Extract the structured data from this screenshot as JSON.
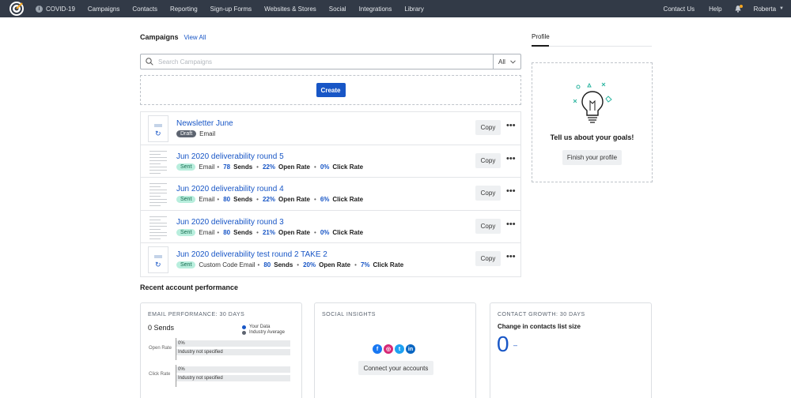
{
  "nav": {
    "items": [
      "COVID-19",
      "Campaigns",
      "Contacts",
      "Reporting",
      "Sign-up Forms",
      "Websites & Stores",
      "Social",
      "Integrations",
      "Library"
    ],
    "right": {
      "contact": "Contact Us",
      "help": "Help",
      "user": "Roberta"
    }
  },
  "campaigns": {
    "title": "Campaigns",
    "view_all": "View All",
    "search_placeholder": "Search Campaigns",
    "filter": "All",
    "create_label": "Create",
    "copy_label": "Copy",
    "rows": [
      {
        "name": "Newsletter June",
        "status": "Draft",
        "type": "Email",
        "sends": "",
        "open": "",
        "click": ""
      },
      {
        "name": "Jun 2020 deliverability round 5",
        "status": "Sent",
        "type": "Email",
        "sends": "78",
        "open": "22%",
        "click": "0%"
      },
      {
        "name": "Jun 2020 deliverability round 4",
        "status": "Sent",
        "type": "Email",
        "sends": "80",
        "open": "22%",
        "click": "6%"
      },
      {
        "name": "Jun 2020 deliverability round 3",
        "status": "Sent",
        "type": "Email",
        "sends": "80",
        "open": "21%",
        "click": "0%"
      },
      {
        "name": "Jun 2020 deliverability test round 2 TAKE 2",
        "status": "Sent",
        "type": "Custom Code Email",
        "sends": "80",
        "open": "20%",
        "click": "7%"
      }
    ],
    "labels": {
      "sends": "Sends",
      "open": "Open Rate",
      "click": "Click Rate"
    }
  },
  "recent": {
    "title": "Recent account performance",
    "email": {
      "label": "EMAIL PERFORMANCE: 30 DAYS",
      "sends": "0 Sends",
      "legend_your": "Your Data",
      "legend_industry": "Industry Average",
      "open_label": "Open Rate",
      "click_label": "Click Rate",
      "open_value": "0%",
      "click_value": "0%",
      "industry_text": "Industry not specified",
      "colors": {
        "your": "#1856c6",
        "industry": "#5d6470"
      }
    },
    "social": {
      "label": "SOCIAL INSIGHTS",
      "connect": "Connect your accounts",
      "icons": [
        "facebook-icon",
        "instagram-icon",
        "twitter-icon",
        "linkedin-icon"
      ]
    },
    "growth": {
      "label": "CONTACT GROWTH: 30 DAYS",
      "title": "Change in contacts list size",
      "value": "0",
      "change": "–"
    }
  },
  "profile": {
    "tab": "Profile",
    "goals": "Tell us about your goals!",
    "finish": "Finish your profile"
  },
  "colors": {
    "nav_bg": "#323a47",
    "accent": "#1856c6",
    "sent_badge": "#b8eedd",
    "draft_badge": "#5d6470"
  }
}
